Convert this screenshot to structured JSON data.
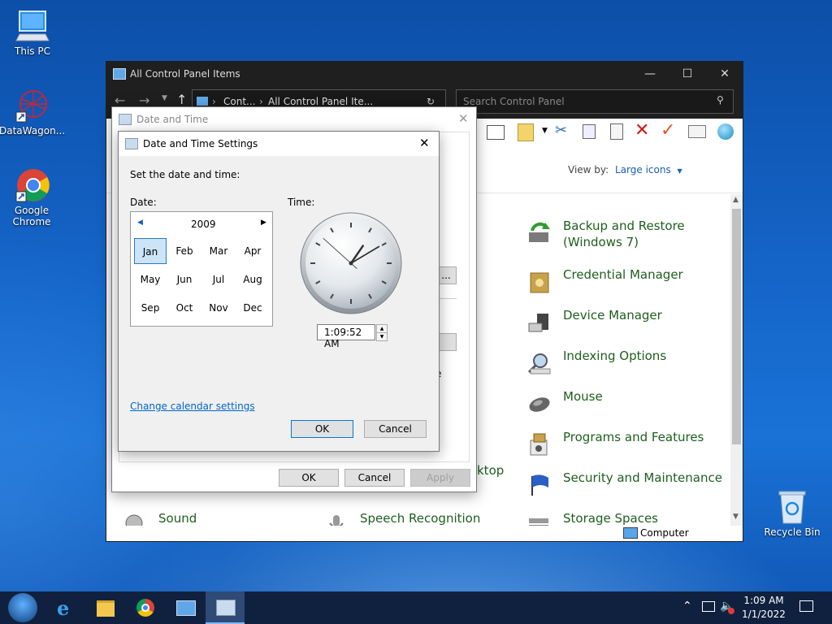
{
  "desktop": {
    "icons": [
      {
        "label": "This PC"
      },
      {
        "label": "DataWagon..."
      },
      {
        "label": "Google Chrome"
      },
      {
        "label": "Recycle Bin"
      }
    ]
  },
  "cp": {
    "title": "All Control Panel Items",
    "breadcrumb": [
      "Cont...",
      "All Control Panel Ite..."
    ],
    "search_placeholder": "Search Control Panel",
    "view_by_label": "View by:",
    "view_by_value": "Large icons",
    "items": [
      {
        "label": "Backup and Restore (Windows 7)"
      },
      {
        "label": "Credential Manager"
      },
      {
        "label": "Device Manager"
      },
      {
        "label": "Indexing Options"
      },
      {
        "label": "Mouse"
      },
      {
        "label": "Programs and Features"
      },
      {
        "label": "Security and Maintenance"
      },
      {
        "label": "Storage Spaces"
      }
    ],
    "bottom_items": [
      {
        "label": "Sound"
      },
      {
        "label": "Speech Recognition"
      }
    ],
    "partial_text": "ktop",
    "status_computer": "Computer"
  },
  "dt": {
    "title": "Date and Time",
    "btn_ok": "OK",
    "btn_cancel": "Cancel",
    "btn_apply": "Apply",
    "partial_btn": "...",
    "partial_e": "e"
  },
  "dts": {
    "title": "Date and Time Settings",
    "instruction": "Set the date and time:",
    "date_label": "Date:",
    "time_label": "Time:",
    "year": "2009",
    "months": [
      "Jan",
      "Feb",
      "Mar",
      "Apr",
      "May",
      "Jun",
      "Jul",
      "Aug",
      "Sep",
      "Oct",
      "Nov",
      "Dec"
    ],
    "selected_month": "Jan",
    "time_value": "1:09:52 AM",
    "clock": {
      "hour": 1,
      "minute": 9,
      "second": 52
    },
    "change_link": "Change calendar settings",
    "btn_ok": "OK",
    "btn_cancel": "Cancel"
  },
  "taskbar": {
    "time": "1:09 AM",
    "date": "1/1/2022"
  },
  "colors": {
    "link": "#0066cc",
    "item_text": "#1e5e1e",
    "titlebar_dark": "#1f1f1f",
    "taskbar": "#10213f"
  }
}
